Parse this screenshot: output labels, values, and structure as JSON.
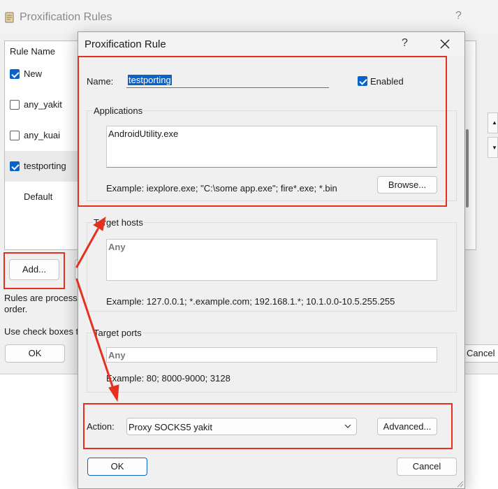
{
  "background_window": {
    "title": "Proxification Rules",
    "help": "?",
    "column_header": "Rule Name",
    "rules": [
      {
        "name": "New",
        "checked": true
      },
      {
        "name": "any_yakit",
        "checked": false
      },
      {
        "name": "any_kuai",
        "checked": false
      },
      {
        "name": "testporting",
        "checked": true,
        "selected": true
      },
      {
        "name": "Default",
        "checked": null
      }
    ],
    "add_button": "Add...",
    "info_line1": "Rules are processe",
    "info_line2": "order.",
    "info_line3": "Use check boxes to",
    "ok_button": "OK",
    "cancel_button": "Cancel"
  },
  "dialog": {
    "title": "Proxification Rule",
    "help": "?",
    "name_label": "Name:",
    "name_value": "testporting",
    "enabled_label": "Enabled",
    "enabled_checked": true,
    "applications": {
      "label": "Applications",
      "value": "AndroidUtility.exe",
      "example": "Example: iexplore.exe; \"C:\\some app.exe\"; fire*.exe; *.bin",
      "browse_button": "Browse..."
    },
    "target_hosts": {
      "label": "Target hosts",
      "value": "Any",
      "example": "Example: 127.0.0.1; *.example.com; 192.168.1.*; 10.1.0.0-10.5.255.255"
    },
    "target_ports": {
      "label": "Target ports",
      "value": "Any",
      "example": "Example: 80; 8000-9000; 3128"
    },
    "action_label": "Action:",
    "action_value": "Proxy SOCKS5 yakit",
    "advanced_button": "Advanced...",
    "ok_button": "OK",
    "cancel_button": "Cancel"
  },
  "colors": {
    "accent": "#0a63c8",
    "annotation_red": "#e53020",
    "window_bg": "#f0f0f0"
  }
}
